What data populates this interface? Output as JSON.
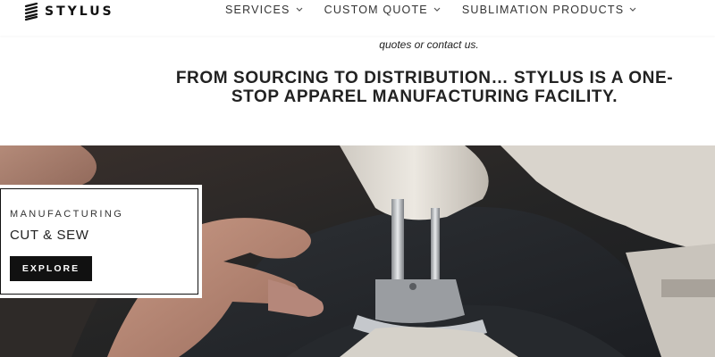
{
  "header": {
    "logo_text": "STYLUS",
    "nav": [
      {
        "label": "SERVICES"
      },
      {
        "label": "CUSTOM QUOTE"
      },
      {
        "label": "SUBLIMATION PRODUCTS"
      }
    ]
  },
  "intro": {
    "italic_note": "quotes or contact us.",
    "headline_line1": "FROM SOURCING TO DISTRIBUTION… STYLUS IS A ONE-",
    "headline_line2": "STOP APPAREL MANUFACTURING FACILITY."
  },
  "card": {
    "kicker": "MANUFACTURING",
    "title": "CUT & SEW",
    "button_label": "EXPLORE"
  },
  "colors": {
    "button_bg": "#111111",
    "text": "#222222",
    "background": "#ffffff"
  }
}
